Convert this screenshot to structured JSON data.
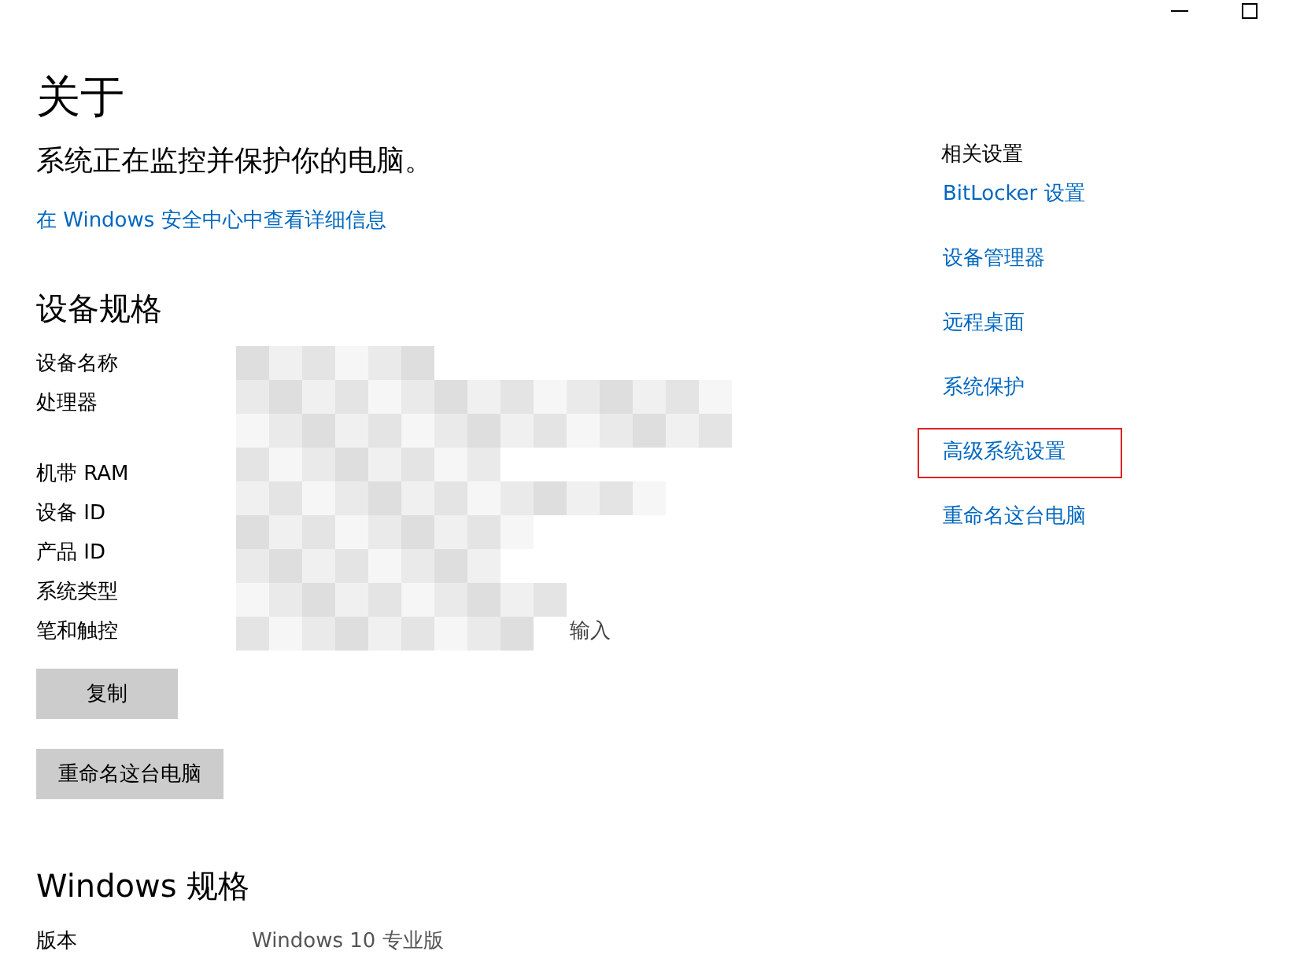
{
  "window": {
    "controls": [
      {
        "kind": "minimize"
      },
      {
        "kind": "maximize"
      }
    ]
  },
  "title": "关于",
  "protection_status": "系统正在监控并保护你的电脑。",
  "security_link": "在 Windows 安全中心中查看详细信息",
  "device_specs": {
    "heading": "设备规格",
    "rows": [
      {
        "label": "设备名称",
        "kind": "single"
      },
      {
        "label": "处理器",
        "kind": "tall"
      },
      {
        "label": "机带 RAM",
        "kind": "single"
      },
      {
        "label": "设备 ID",
        "kind": "single"
      },
      {
        "label": "产品 ID",
        "kind": "single"
      },
      {
        "label": "系统类型",
        "kind": "single"
      },
      {
        "label": "笔和触控",
        "kind": "single",
        "value": "输入"
      }
    ],
    "buttons": [
      "复制",
      "重命名这台电脑"
    ]
  },
  "windows_specs": {
    "heading": "Windows 规格",
    "rows": [
      {
        "label": "版本",
        "value": "Windows 10 专业版"
      }
    ]
  },
  "related_settings": {
    "heading": "相关设置",
    "links": [
      {
        "label": "BitLocker 设置",
        "highlighted": false
      },
      {
        "label": "设备管理器",
        "highlighted": false
      },
      {
        "label": "远程桌面",
        "highlighted": false
      },
      {
        "label": "系统保护",
        "highlighted": false
      },
      {
        "label": "高级系统设置",
        "highlighted": true
      },
      {
        "label": "重命名这台电脑",
        "highlighted": false
      }
    ]
  }
}
